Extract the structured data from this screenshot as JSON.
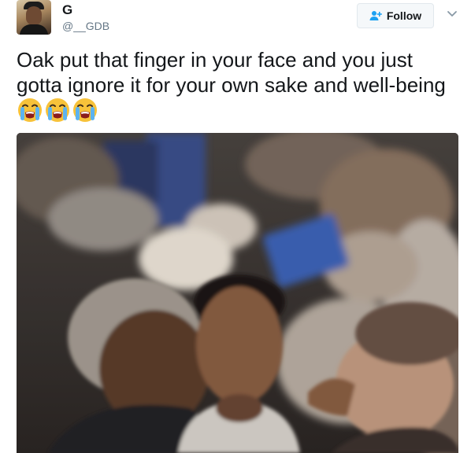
{
  "tweet": {
    "author_name": "G",
    "author_handle": "@__GDB",
    "follow_label": "Follow",
    "text": "Oak put that finger in your face and you just gotta ignore it for your own sake and well-being",
    "emojis": [
      "loudly-crying-face",
      "loudly-crying-face",
      "loudly-crying-face"
    ]
  },
  "icons": {
    "follow": "follow-person-plus-icon",
    "menu": "chevron-down-icon",
    "emoji": "loudly-crying-face-emoji"
  },
  "colors": {
    "name": "#14171a",
    "handle": "#657786",
    "follow_icon": "#1da1f2",
    "button_bg": "#f5f8fa",
    "button_border": "#e1e8ed"
  }
}
